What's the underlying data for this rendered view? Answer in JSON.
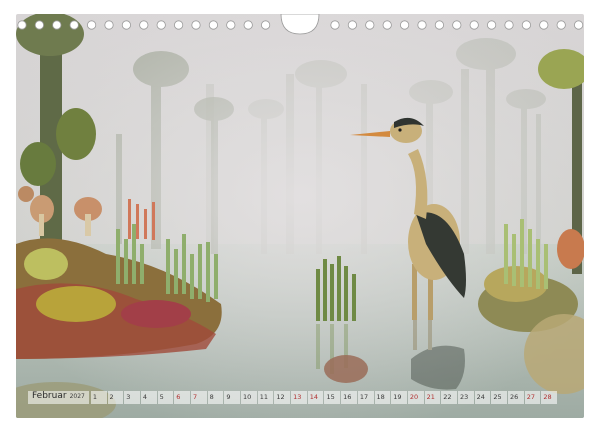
{
  "calendar": {
    "month": "Februar",
    "year": "2027",
    "days": [
      "1",
      "2",
      "3",
      "4",
      "5",
      "6",
      "7",
      "8",
      "9",
      "10",
      "11",
      "12",
      "13",
      "14",
      "15",
      "16",
      "17",
      "18",
      "19",
      "20",
      "21",
      "22",
      "23",
      "24",
      "25",
      "26",
      "27",
      "28"
    ],
    "weekend_days": [
      "6",
      "7",
      "13",
      "14",
      "20",
      "21",
      "27",
      "28"
    ],
    "weekend_color": "#b03030"
  },
  "binding": {
    "hole_count_left": 15,
    "hole_count_right": 15
  },
  "photo": {
    "subject": "crochet heron in misty swamp"
  }
}
